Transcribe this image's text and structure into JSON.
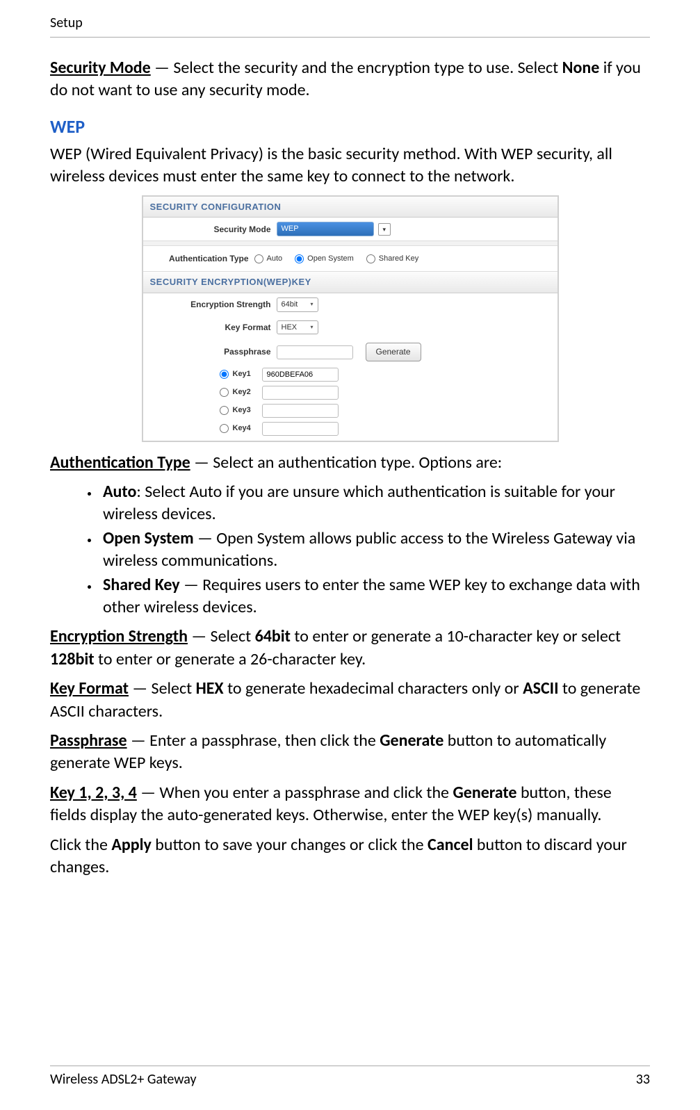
{
  "header": {
    "title": "Setup"
  },
  "intro": {
    "label": "Security Mode",
    "dash": " — ",
    "text": "Select the security and the encryption type to use. Select ",
    "none": "None",
    "tail": " if you do not want to use any security mode."
  },
  "wep": {
    "title": "WEP",
    "desc": "WEP (Wired Equivalent Privacy) is the basic security method. With WEP security, all wireless devices must enter the same key to connect to the network."
  },
  "shot": {
    "head1": "SECURITY CONFIGURATION",
    "secModeLabel": "Security Mode",
    "secModeValue": "WEP",
    "authLabel": "Authentication Type",
    "auth": {
      "auto": "Auto",
      "open": "Open System",
      "shared": "Shared Key"
    },
    "head2": "SECURITY ENCRYPTION(WEP)KEY",
    "encLabel": "Encryption Strength",
    "encValue": "64bit",
    "fmtLabel": "Key Format",
    "fmtValue": "HEX",
    "passLabel": "Passphrase",
    "passValue": "",
    "generate": "Generate",
    "keys": {
      "k1": {
        "label": "Key1",
        "value": "960DBEFA06"
      },
      "k2": {
        "label": "Key2",
        "value": ""
      },
      "k3": {
        "label": "Key3",
        "value": ""
      },
      "k4": {
        "label": "Key4",
        "value": ""
      }
    }
  },
  "authType": {
    "lead": "Authentication Type",
    "dash": " — ",
    "text": "Select an authentication type. Options are:",
    "items": [
      {
        "b": "Auto",
        "sep": ": ",
        "t": "Select Auto if you are unsure which authentication is suitable for your wireless devices."
      },
      {
        "b": "Open System",
        "sep": " — ",
        "t": "Open System allows public access to the Wireless Gateway via wireless communications."
      },
      {
        "b": "Shared Key",
        "sep": " — ",
        "t": "Requires users to enter the same WEP key to exchange data with other wireless devices."
      }
    ]
  },
  "enc": {
    "lead": "Encryption Strength",
    "dash": " — ",
    "t1": "Select ",
    "b1": "64bit",
    "t2": " to enter or generate a 10-character key or select ",
    "b2": "128bit",
    "t3": " to enter or generate a 26-character key."
  },
  "fmt": {
    "lead": "Key Format",
    "dash": " — ",
    "t1": "Select ",
    "b1": "HEX",
    "t2": " to generate hexadecimal characters only or ",
    "b2": "ASCII",
    "t3": " to generate ASCII characters."
  },
  "pass": {
    "lead": "Passphrase",
    "dash": " — ",
    "t1": "Enter a passphrase, then click the ",
    "b1": "Generate",
    "t2": " button to automatically generate WEP keys."
  },
  "keys": {
    "lead": "Key 1, 2, 3, 4",
    "dash": " — ",
    "t1": "When you enter a passphrase and click the ",
    "b1": "Generate",
    "t2": " button, these fields display the auto-generated keys. Otherwise, enter the WEP key(s) manually."
  },
  "applyCancel": {
    "t1": "Click the ",
    "b1": "Apply",
    "t2": " button to save your changes or click the ",
    "b2": "Cancel",
    "t3": " button to discard your changes."
  },
  "footer": {
    "left": "Wireless ADSL2+ Gateway",
    "right": "33"
  }
}
